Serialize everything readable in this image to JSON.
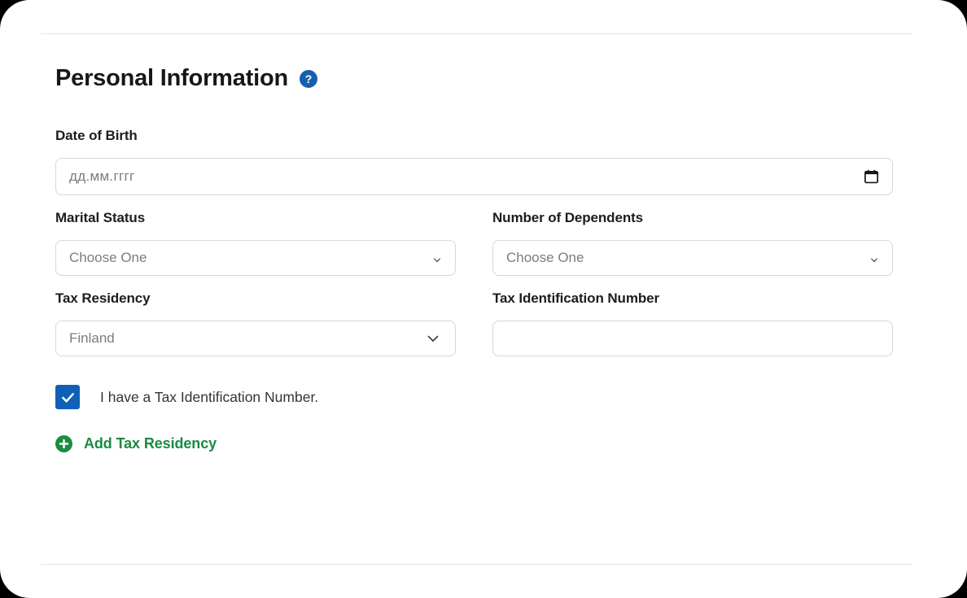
{
  "section": {
    "title": "Personal Information",
    "help_icon_glyph": "?",
    "help_icon_color": "#1560ae"
  },
  "fields": {
    "date_of_birth": {
      "label": "Date of Birth",
      "value": "",
      "placeholder": "дд.мм.гггг",
      "icon": "calendar-icon"
    },
    "marital_status": {
      "label": "Marital Status",
      "value": "Choose One",
      "icon": "chevron-down-icon"
    },
    "number_of_dependents": {
      "label": "Number of Dependents",
      "value": "Choose One",
      "icon": "chevron-down-icon"
    },
    "tax_residency": {
      "label": "Tax Residency",
      "value": "Finland",
      "icon": "chevron-down-icon"
    },
    "tax_identification_number": {
      "label": "Tax Identification Number",
      "value": "",
      "placeholder": ""
    }
  },
  "checkbox": {
    "label": "I have a Tax Identification Number.",
    "checked": true,
    "color": "#1160b8"
  },
  "add_link": {
    "label": "Add Tax Residency",
    "icon": "plus-circle-icon",
    "color": "#1a8a43"
  }
}
